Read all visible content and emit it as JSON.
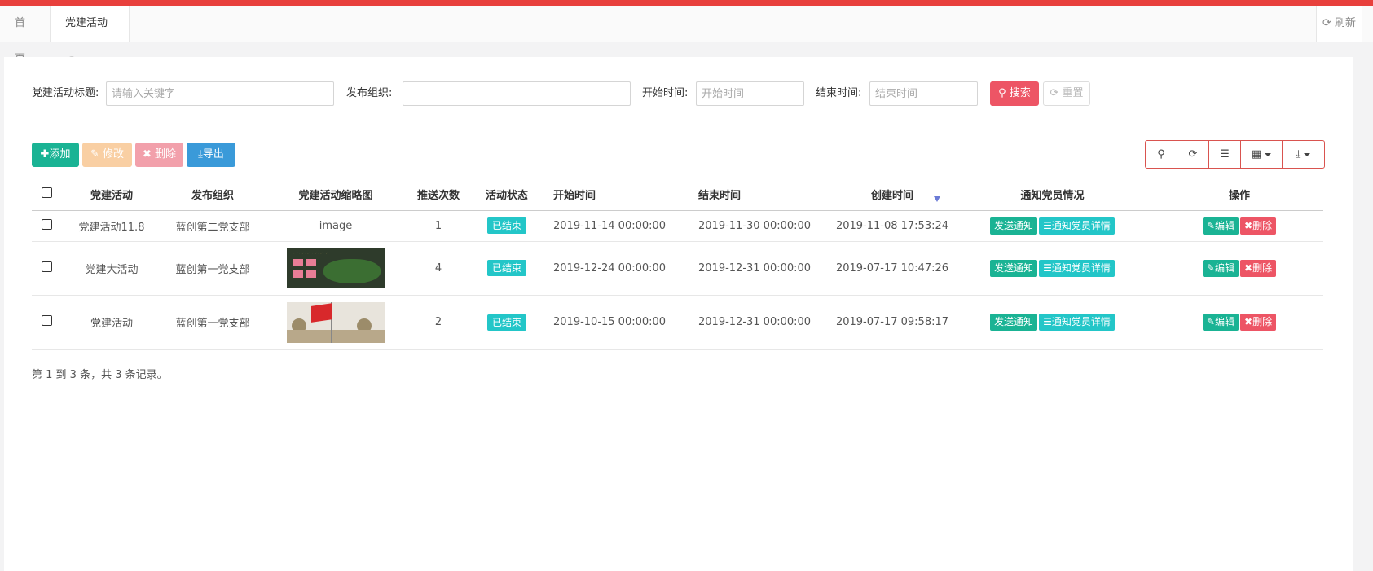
{
  "tabs": {
    "home": "首页",
    "active": "党建活动",
    "refresh": "刷新"
  },
  "search": {
    "title_label": "党建活动标题:",
    "title_placeholder": "请输入关键字",
    "org_label": "发布组织:",
    "org_placeholder": "",
    "start_label": "开始时间:",
    "start_placeholder": "开始时间",
    "end_label": "结束时间:",
    "end_placeholder": "结束时间",
    "search_btn": "搜索",
    "reset_btn": "重置"
  },
  "toolbar": {
    "add": "添加",
    "edit": "修改",
    "delete": "删除",
    "export": "导出"
  },
  "table": {
    "headers": [
      "党建活动",
      "发布组织",
      "党建活动缩略图",
      "推送次数",
      "活动状态",
      "开始时间",
      "结束时间",
      "创建时间",
      "通知党员情况",
      "操作"
    ],
    "rows": [
      {
        "activity": "党建活动11.8",
        "org": "蓝创第二党支部",
        "thumb_text": "image",
        "push": "1",
        "status": "已结束",
        "start": "2019-11-14 00:00:00",
        "end": "2019-11-30 00:00:00",
        "created": "2019-11-08 17:53:24",
        "send": "发送通知",
        "detail": "通知党员详情",
        "edit": "编辑",
        "del": "删除"
      },
      {
        "activity": "党建大活动",
        "org": "蓝创第一党支部",
        "push": "4",
        "status": "已结束",
        "start": "2019-12-24 00:00:00",
        "end": "2019-12-31 00:00:00",
        "created": "2019-07-17 10:47:26",
        "send": "发送通知",
        "detail": "通知党员详情",
        "edit": "编辑",
        "del": "删除"
      },
      {
        "activity": "党建活动",
        "org": "蓝创第一党支部",
        "push": "2",
        "status": "已结束",
        "start": "2019-10-15 00:00:00",
        "end": "2019-12-31 00:00:00",
        "created": "2019-07-17 09:58:17",
        "send": "发送通知",
        "detail": "通知党员详情",
        "edit": "编辑",
        "del": "删除"
      }
    ]
  },
  "pagination": {
    "summary": "第 1 到 3 条，共 3 条记录。"
  },
  "icons": [
    "refresh-icon",
    "close-circle-icon",
    "search-icon",
    "plus-icon",
    "edit-icon",
    "times-icon",
    "download-icon",
    "list-icon",
    "grid-icon",
    "sort-desc-icon"
  ],
  "colors": {
    "topbar": "#e8403c",
    "primary": "#1ab394",
    "info": "#23c6c8",
    "danger": "#ed5565"
  }
}
